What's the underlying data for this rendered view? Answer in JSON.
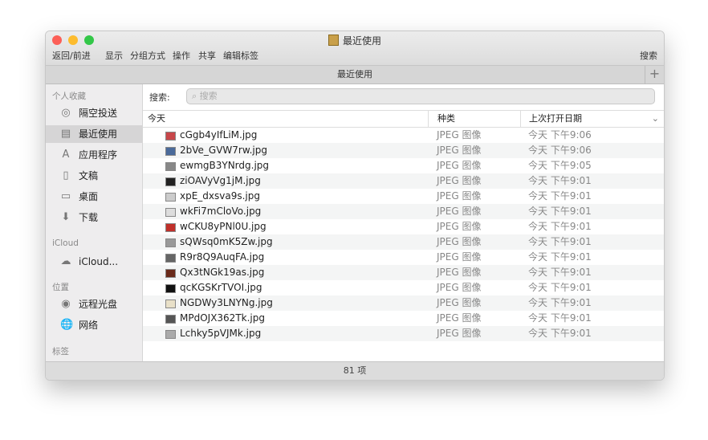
{
  "window": {
    "title": "最近使用",
    "tab": "最近使用",
    "status": "81 项"
  },
  "toolbar": {
    "back_forward": "返回/前进",
    "view": "显示",
    "group": "分组方式",
    "action": "操作",
    "share": "共享",
    "tags": "编辑标签",
    "search": "搜索",
    "new_tab": "+"
  },
  "sidebar": {
    "favorites_header": "个人收藏",
    "favorites": [
      {
        "label": "隔空投送",
        "icon": "airdrop-icon"
      },
      {
        "label": "最近使用",
        "icon": "recents-icon"
      },
      {
        "label": "应用程序",
        "icon": "applications-icon"
      },
      {
        "label": "文稿",
        "icon": "documents-icon"
      },
      {
        "label": "桌面",
        "icon": "desktop-icon"
      },
      {
        "label": "下载",
        "icon": "downloads-icon"
      }
    ],
    "icloud_header": "iCloud",
    "icloud": [
      {
        "label": "iCloud...",
        "icon": "cloud-icon"
      }
    ],
    "locations_header": "位置",
    "locations": [
      {
        "label": "远程光盘",
        "icon": "disc-icon"
      },
      {
        "label": "网络",
        "icon": "network-icon"
      }
    ],
    "tags_header": "标签"
  },
  "search": {
    "label": "搜索:",
    "placeholder": "搜索"
  },
  "columns": {
    "name": "今天",
    "kind": "种类",
    "date": "上次打开日期"
  },
  "files": [
    {
      "name": "cGgb4yIfLiM.jpg",
      "kind": "JPEG 图像",
      "date": "今天 下午9:06",
      "color": "#c8474a"
    },
    {
      "name": "2bVe_GVW7rw.jpg",
      "kind": "JPEG 图像",
      "date": "今天 下午9:06",
      "color": "#4a6a9a"
    },
    {
      "name": "ewmgB3YNrdg.jpg",
      "kind": "JPEG 图像",
      "date": "今天 下午9:05",
      "color": "#888888"
    },
    {
      "name": "ziOAVyVg1jM.jpg",
      "kind": "JPEG 图像",
      "date": "今天 下午9:01",
      "color": "#222222"
    },
    {
      "name": "xpE_dxsva9s.jpg",
      "kind": "JPEG 图像",
      "date": "今天 下午9:01",
      "color": "#cccccc"
    },
    {
      "name": "wkFi7mCloVo.jpg",
      "kind": "JPEG 图像",
      "date": "今天 下午9:01",
      "color": "#dddddd"
    },
    {
      "name": "wCKU8yPNl0U.jpg",
      "kind": "JPEG 图像",
      "date": "今天 下午9:01",
      "color": "#c0302a"
    },
    {
      "name": "sQWsq0mK5Zw.jpg",
      "kind": "JPEG 图像",
      "date": "今天 下午9:01",
      "color": "#999999"
    },
    {
      "name": "R9r8Q9AuqFA.jpg",
      "kind": "JPEG 图像",
      "date": "今天 下午9:01",
      "color": "#666666"
    },
    {
      "name": "Qx3tNGk19as.jpg",
      "kind": "JPEG 图像",
      "date": "今天 下午9:01",
      "color": "#6a2a1a"
    },
    {
      "name": "qcKGSKrTVOI.jpg",
      "kind": "JPEG 图像",
      "date": "今天 下午9:01",
      "color": "#111111"
    },
    {
      "name": "NGDWy3LNYNg.jpg",
      "kind": "JPEG 图像",
      "date": "今天 下午9:01",
      "color": "#e8e0c8"
    },
    {
      "name": "MPdOJX362Tk.jpg",
      "kind": "JPEG 图像",
      "date": "今天 下午9:01",
      "color": "#555555"
    },
    {
      "name": "Lchky5pVJMk.jpg",
      "kind": "JPEG 图像",
      "date": "今天 下午9:01",
      "color": "#aaaaaa"
    }
  ]
}
